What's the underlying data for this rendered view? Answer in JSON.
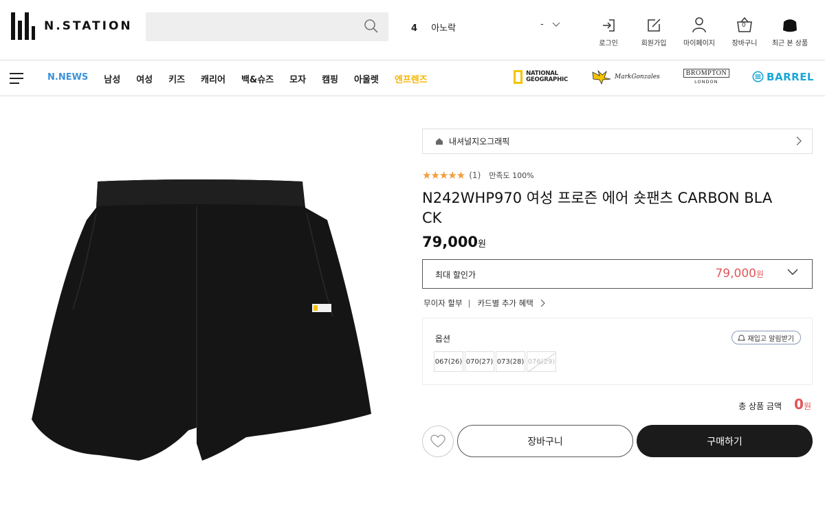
{
  "header": {
    "logo_text": "N.STATION",
    "search": {
      "placeholder": ""
    },
    "rank": {
      "number": "4",
      "keyword": "아노락"
    },
    "rank_dropdown_label": "-",
    "utils": [
      {
        "icon": "login-icon",
        "label": "로그인"
      },
      {
        "icon": "signup-icon",
        "label": "회원가입"
      },
      {
        "icon": "user-icon",
        "label": "마이페이지"
      },
      {
        "icon": "cart-icon",
        "label": "장바구니",
        "badge": "0"
      },
      {
        "icon": "recent-view-icon",
        "label": "최근 본 상품"
      }
    ]
  },
  "gnb": {
    "menu": [
      "N.NEWS",
      "남성",
      "여성",
      "키즈",
      "캐리어",
      "백&슈즈",
      "모자",
      "캠핑",
      "아울렛",
      "엔프렌즈"
    ],
    "brands": {
      "national_geographic": [
        "NATIONAL",
        "GEOGRAPHIC"
      ],
      "mark_gonzales": "MarkGonzales",
      "brompton": [
        "BROMPTON",
        "LONDON"
      ],
      "barrel": "BARREL"
    }
  },
  "product": {
    "breadcrumb": "내셔널지오그래픽",
    "rating": {
      "stars": "★★★★★",
      "count": "(1)",
      "satisfaction": "만족도 100%"
    },
    "title": "N242WHP970 여성 프로즌 에어 숏팬츠 CARBON BLACK",
    "price": "79,000",
    "price_unit": "원",
    "max_discount": {
      "label": "최대 할인가",
      "value": "79,000",
      "unit": "원"
    },
    "benefits": {
      "installment": "무이자 할부",
      "card": "카드별 추가 혜택"
    },
    "options": {
      "label": "옵션",
      "restock_label": "재입고 알림받기",
      "sizes": [
        {
          "label": "067(26)",
          "sold_out": false
        },
        {
          "label": "070(27)",
          "sold_out": false
        },
        {
          "label": "073(28)",
          "sold_out": false
        },
        {
          "label": "076(29)",
          "sold_out": true
        }
      ]
    },
    "total": {
      "label": "총 상품 금액",
      "value": "0",
      "unit": "원"
    },
    "buttons": {
      "cart": "장바구니",
      "buy": "구매하기"
    }
  },
  "colors": {
    "accent_red": "#e05757",
    "news_blue": "#3d92d9",
    "friends_yellow": "#f5b500",
    "star_orange": "#f39d3c"
  }
}
